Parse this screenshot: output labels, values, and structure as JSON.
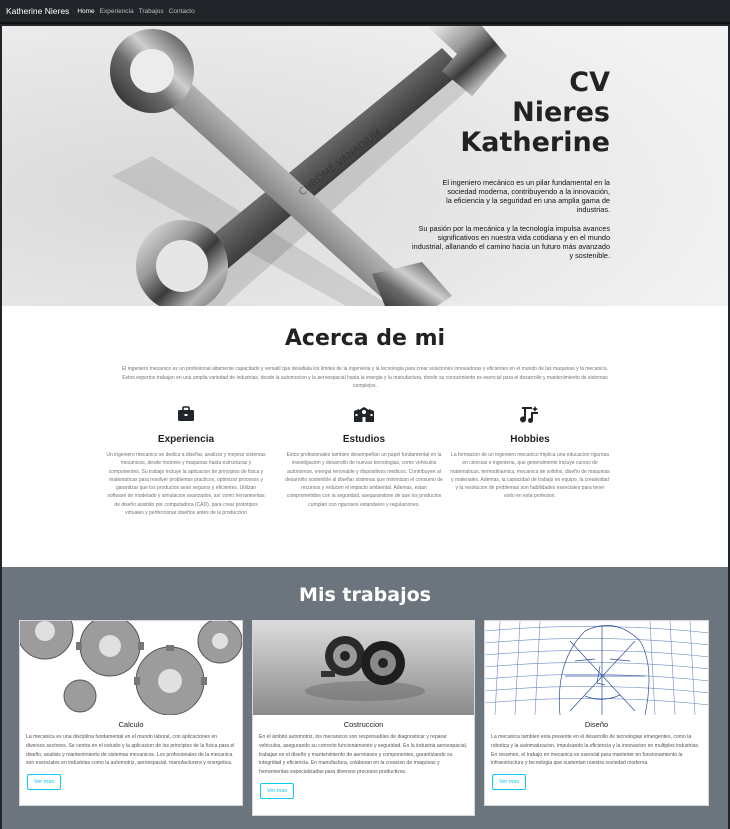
{
  "navbar": {
    "brand": "Katherine Nieres",
    "links": [
      "Home",
      "Experiencia",
      "Trabajos",
      "Contacto"
    ]
  },
  "hero": {
    "title_lines": [
      "CV",
      "Nieres",
      "Katherine"
    ],
    "paragraph1": "El ingeniero mecánico es un pilar fundamental en la sociedad moderna, contribuyendo a la innovación, la eficiencia y la seguridad en una amplia gama de industrias.",
    "paragraph2": "Su pasión por la mecánica y la tecnología impulsa avances significativos en nuestra vida cotidiana y en el mundo industrial, allanando el camino hacia un futuro más avanzado y sostenible."
  },
  "about": {
    "title": "Acerca de mi",
    "intro": "El ingeniero mecanico es un profesional altamente capacitado y versatil que desafiala los limites de la ingenieria y la tecnologia para crear soluciones innovadoras y eficientes en el mundo de las maquinas y la mecanica. Estos expertos trabajan en una amplia variedad de industrias, desde la automocion y la aeroespacial hasta la energia y la manufactura, donde su conocimiento es esencial para el desarrollo y mantenimiento de sistemas complejos.",
    "features": [
      {
        "icon": "briefcase-icon",
        "title": "Experiencia",
        "text": "Un ingeniero mecanico se dedica a diseñar, analizar y mejorar sistemas mecanicos, desde motores y maquinas hasta estructuras y componentes. Su trabajo incluye la aplicacion de principios de fisica y matematicas para resolver problemas practicos, optimizar procesos y garantizar que los productos sean seguros y eficientes. Utilizan software de modelado y simulacion avanzados, así como herramientas de diseño asistido por computadora (CAD), para crear prototipos virtuales y perfeccionar diseños antes de la produccion"
      },
      {
        "icon": "school-building-icon",
        "title": "Estudios",
        "text": "Estos profesionales tambien desempeñan un papel fundamental en la investigacion y desarrollo de nuevas tecnologias, como vehiculos autonomos, energia renovable y dispositivos medicos. Contribuyen al desarrollo sostenible al diseñar sistemas que minimizan el consumo de recursos y reducen el impacto ambiental. Ademas, estan comprometidos con la seguridad, asegurandose de que los productos cumplan con rigurosos estandares y regulaciones."
      },
      {
        "icon": "music-sparkle-icon",
        "title": "Hobbies",
        "text": "La formacion de un ingeniero mecanico implica una educacion rigurosa en ciencias e ingenieria, que generalmente incluye cursos de matematicas, termodinamica, mecanica de solidos, diseño de maquinas y materiales. Ademas, la capacidad de trabajo en equipo, la creatividad y la resolucion de problemas son habilidades esenciales para tener exito en esta profesion."
      }
    ]
  },
  "works": {
    "title": "Mis trabajos",
    "cards": [
      {
        "title": "Calculo",
        "text": "La mecanica es una disciplina fundamental en el mundo laboral, con aplicaciones en diversos sectores. Se centra en el estudio y la aplicacion de los principios de la fisica para el diseño, analisis y mantenimiento de sistemas mecanicos. Los profesionales de la mecanica son esenciales en industrias como la automotriz, aeroespacial, manufacturera y energetica.",
        "button": "Ver mas"
      },
      {
        "title": "Costruccion",
        "text": "En el ámbito automotriz, los mecanicos son responsables de diagnosticar y reparar vehiculos, asegurando su correcto funcionamiento y seguridad. En la industria aeroespacial, trabajan en el diseño y mantenimiento de aeronaves y componentes, garantizando su integridad y eficiencia. En manufactura, colaboran en la creacion de maquinas y herramientas especializadas para diversos procesos productivos.",
        "button": "Ver mas"
      },
      {
        "title": "Diseño",
        "text": "La mecanica tambien esta presente en el desarrollo de tecnologias emergentes, como la robotica y la automatizacion, impulsando la eficiencia y la innovacion en multiples industrias. En resumen, el trabajo en mecanica es esencial para mantener en funcionamiento la infraestructura y tecnologia que sustentan nuestra sociedad moderna.",
        "button": "Ver mas"
      }
    ]
  },
  "colors": {
    "navbar": "#212529",
    "works_bg": "#6c757d",
    "button_accent": "#0dcaf0"
  }
}
